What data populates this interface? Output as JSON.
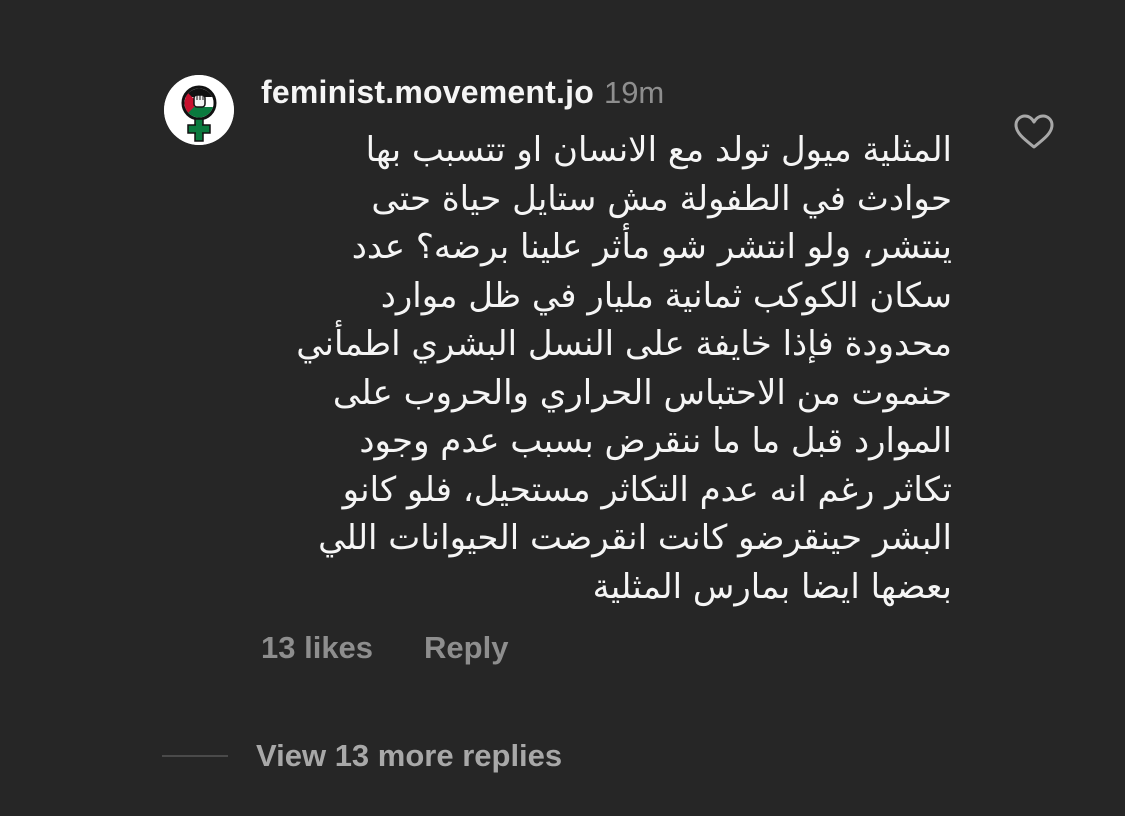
{
  "comment": {
    "username": "feminist.movement.jo",
    "time": "19m",
    "avatar_icon": "feminist-logo-icon",
    "like_icon": "heart-outline-icon",
    "body_lines": [
      "المثلية ميول تولد مع الانسان او تتسبب بها",
      "حوادث في الطفولة مش ستايل حياة حتى",
      "ينتشر، ولو انتشر شو مأثر علينا برضه؟ عدد",
      "سكان الكوكب ثمانية مليار في ظل موارد",
      "محدودة فإذا خايفة على النسل البشري اطمأني",
      "حنموت من الاحتباس الحراري والحروب على",
      "الموارد قبل ما ما ننقرض بسبب عدم وجود",
      "تكاثر رغم انه عدم التكاثر مستحيل، فلو كانو",
      "البشر حينقرضو كانت انقرضت الحيوانات اللي",
      "بعضها ايضا بمارس المثلية"
    ],
    "likes": "13 likes",
    "reply_label": "Reply"
  },
  "more_replies": {
    "label": "View 13 more replies"
  },
  "colors": {
    "background": "#262626",
    "text": "#f5f5f5",
    "secondary": "#8e8e8e",
    "logo_red": "#c8102e",
    "logo_green": "#0a7a3e"
  }
}
